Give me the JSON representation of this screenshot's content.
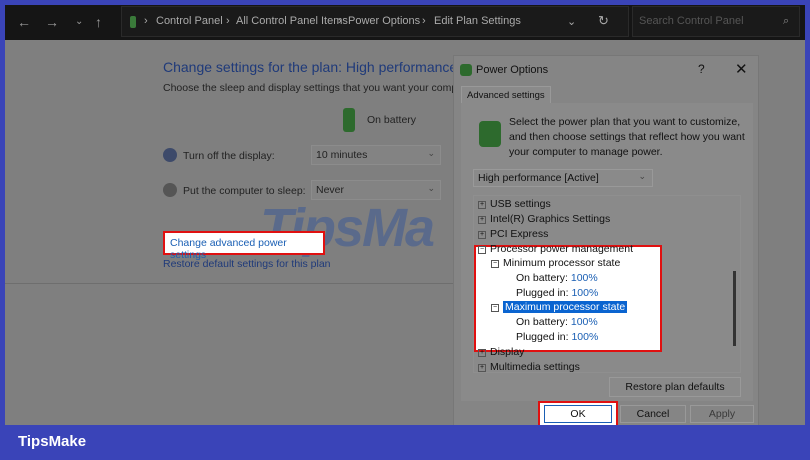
{
  "breadcrumb": [
    "Control Panel",
    "All Control Panel Items",
    "Power Options",
    "Edit Plan Settings"
  ],
  "search_placeholder": "Search Control Panel",
  "main": {
    "title": "Change settings for the plan: High performance",
    "subtitle": "Choose the sleep and display settings that you want your computer to use.",
    "on_battery": "On battery",
    "display_label": "Turn off the display:",
    "display_value": "10 minutes",
    "sleep_label": "Put the computer to sleep:",
    "sleep_value": "Never",
    "advanced_link": "Change advanced power settings",
    "restore_link": "Restore default settings for this plan"
  },
  "dialog": {
    "title": "Power Options",
    "help": "?",
    "close": "✕",
    "tab": "Advanced settings",
    "description": "Select the power plan that you want to customize, and then choose settings that reflect how you want your computer to manage power.",
    "plan": "High performance [Active]",
    "tree": {
      "usb": "USB settings",
      "graphics": "Intel(R) Graphics Settings",
      "pci": "PCI Express",
      "processor": "Processor power management",
      "min": "Minimum processor state",
      "max": "Maximum processor state",
      "on_battery": "On battery:",
      "plugged_in": "Plugged in:",
      "min_battery": "100%",
      "min_plugged": "100%",
      "max_battery": "100%",
      "max_plugged": "100%",
      "display": "Display",
      "multimedia": "Multimedia settings"
    },
    "restore_button": "Restore plan defaults",
    "ok": "OK",
    "cancel": "Cancel",
    "apply": "Apply"
  },
  "watermark": "TipsMake",
  "brand": "TipsMake"
}
